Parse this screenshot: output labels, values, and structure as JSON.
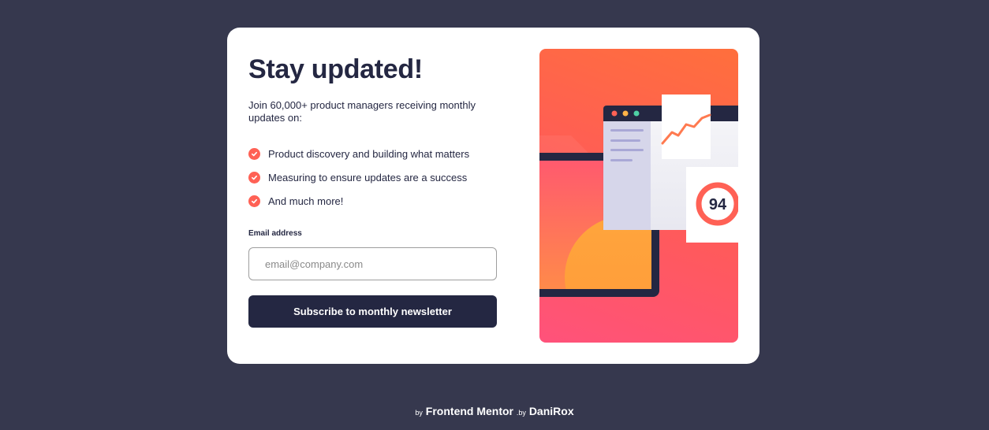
{
  "card": {
    "title": "Stay updated!",
    "intro": "Join 60,000+ product managers receiving monthly updates on:",
    "benefits": [
      "Product discovery and building what matters",
      "Measuring to ensure updates are a success",
      "And much more!"
    ],
    "email_label": "Email address",
    "email_placeholder": "email@company.com",
    "email_value": "",
    "subscribe_label": "Subscribe to monthly newsletter",
    "illustration": {
      "score": "94"
    }
  },
  "attribution": {
    "by1": "by",
    "brand": "Frontend Mentor",
    "by2": ".by",
    "author": "DaniRox"
  },
  "colors": {
    "background": "#36384e",
    "card": "#ffffff",
    "dark_navy": "#242742",
    "tomato": "#ff6155",
    "gradient_top": "#ff6f3c",
    "gradient_bottom": "#ff527b"
  },
  "icons": {
    "check": "check-circle-icon"
  }
}
